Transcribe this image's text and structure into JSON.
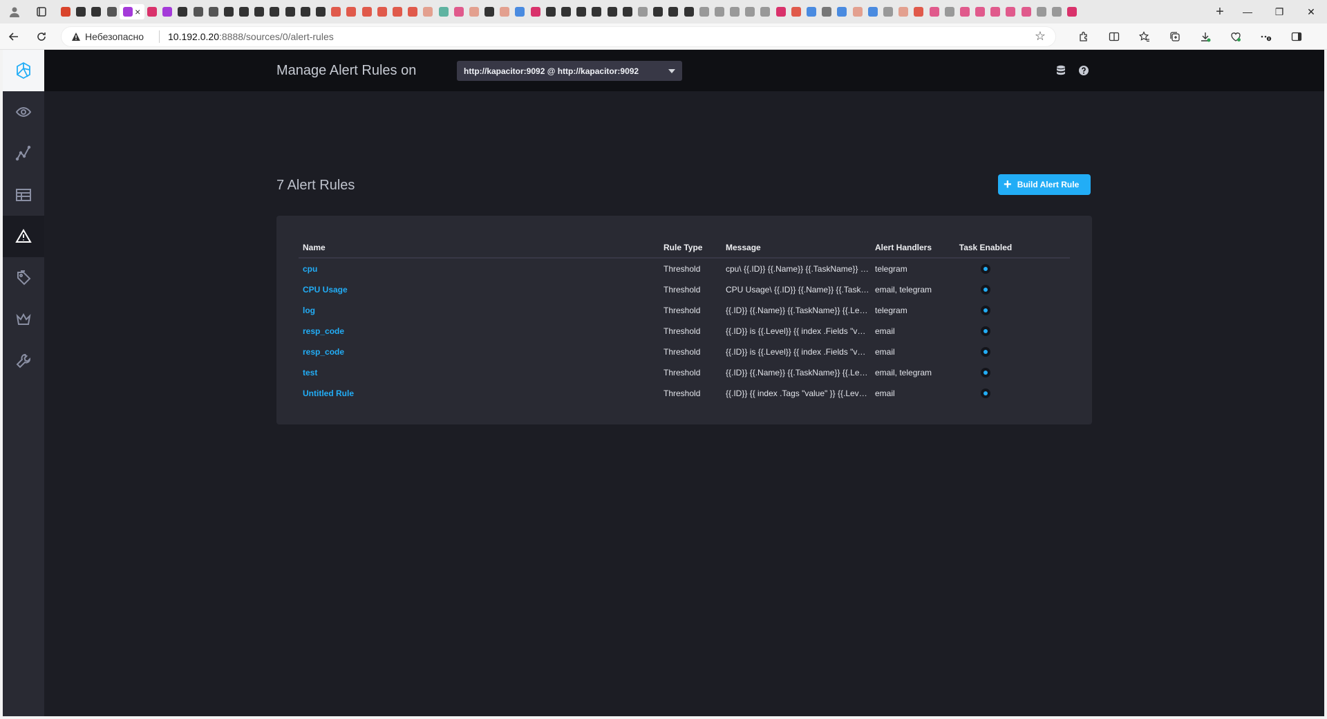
{
  "browser": {
    "security_label": "Небезопасно",
    "url_host": "10.192.0.20",
    "url_path": ":8888/sources/0/alert-rules",
    "favicon_colors": [
      "#d9442c",
      "#333333",
      "#333333",
      "#555555",
      "#a43ad9",
      "#d9326b",
      "#a43ad9",
      "#333333",
      "#555555",
      "#555555",
      "#333333",
      "#333333",
      "#333333",
      "#333333",
      "#333333",
      "#333333",
      "#333333",
      "#e05a4b",
      "#e05a4b",
      "#e05a4b",
      "#e05a4b",
      "#e05a4b",
      "#e05a4b",
      "#e3a08f",
      "#5fb3a1",
      "#e05a8c",
      "#e3a08f",
      "#333333",
      "#e3a08f",
      "#4a8be0",
      "#d9326b",
      "#333333",
      "#333333",
      "#333333",
      "#333333",
      "#333333",
      "#333333",
      "#999999",
      "#333333",
      "#333333",
      "#333333",
      "#999999",
      "#999999",
      "#999999",
      "#999999",
      "#999999",
      "#d9326b",
      "#e05a4b",
      "#4a8be0",
      "#777777",
      "#4a8be0",
      "#e3a08f",
      "#4a8be0",
      "#999999",
      "#e3a08f",
      "#e05a4b",
      "#e05a8c",
      "#999999",
      "#e05a8c",
      "#e05a8c",
      "#e05a8c",
      "#e05a8c",
      "#e05a8c",
      "#999999",
      "#999999",
      "#d9326b"
    ]
  },
  "header": {
    "title": "Manage Alert Rules on",
    "kapacitor_selected": "http://kapacitor:9092 @ http://kapacitor:9092"
  },
  "sidebar": {
    "items": [
      {
        "name": "host-explorer",
        "icon": "eye-icon"
      },
      {
        "name": "data-explorer",
        "icon": "graph-icon"
      },
      {
        "name": "dashboards",
        "icon": "grid-icon"
      },
      {
        "name": "alerting",
        "icon": "alert-triangle-icon",
        "active": true
      },
      {
        "name": "log-viewer",
        "icon": "tags-icon"
      },
      {
        "name": "admin",
        "icon": "crown-icon"
      },
      {
        "name": "configuration",
        "icon": "wrench-icon"
      }
    ]
  },
  "main": {
    "rules_count_label": "7 Alert Rules",
    "build_button_label": "Build Alert Rule",
    "table": {
      "columns": [
        "Name",
        "Rule Type",
        "Message",
        "Alert Handlers",
        "Task Enabled"
      ],
      "rows": [
        {
          "name": "cpu",
          "type": "Threshold",
          "message": "cpu\\ {{.ID}} {{.Name}} {{.TaskName}} {{.Level}}",
          "handlers": "telegram",
          "enabled": true
        },
        {
          "name": "CPU Usage",
          "type": "Threshold",
          "message": "CPU Usage\\ {{.ID}} {{.Name}} {{.TaskName}}",
          "handlers": "email, telegram",
          "enabled": true
        },
        {
          "name": "log",
          "type": "Threshold",
          "message": "{{.ID}} {{.Name}} {{.TaskName}} {{.Level}}",
          "handlers": "telegram",
          "enabled": true
        },
        {
          "name": "resp_code",
          "type": "Threshold",
          "message": "{{.ID}} is {{.Level}} {{ index .Fields \"value\" }}",
          "handlers": "email",
          "enabled": true
        },
        {
          "name": "resp_code",
          "type": "Threshold",
          "message": "{{.ID}} is {{.Level}} {{ index .Fields \"value\" }}",
          "handlers": "email",
          "enabled": true
        },
        {
          "name": "test",
          "type": "Threshold",
          "message": "{{.ID}} {{.Name}} {{.TaskName}} {{.Level}}",
          "handlers": "email, telegram",
          "enabled": true
        },
        {
          "name": "Untitled Rule",
          "type": "Threshold",
          "message": "{{.ID}} {{ index .Tags \"value\" }} {{.Level}}",
          "handlers": "email",
          "enabled": true
        }
      ]
    }
  },
  "colors": {
    "accent": "#22adf6",
    "background": "#1c1d24",
    "panel": "#292a33"
  }
}
